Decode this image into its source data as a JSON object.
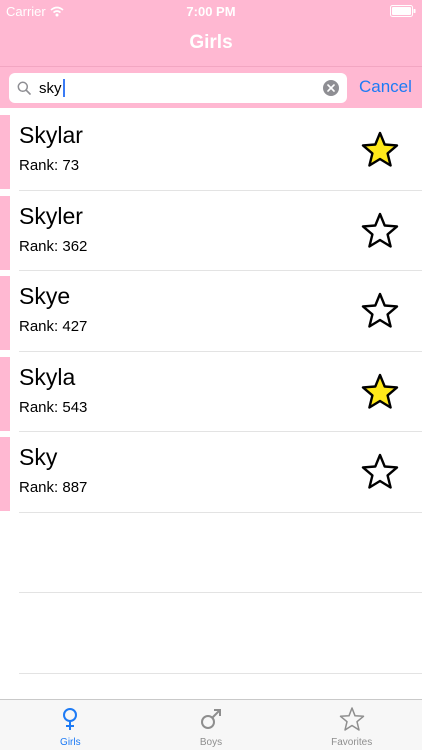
{
  "status_bar": {
    "carrier": "Carrier",
    "time": "7:00 PM"
  },
  "nav": {
    "title": "Girls"
  },
  "search": {
    "value": "sky",
    "cancel_label": "Cancel"
  },
  "results": [
    {
      "name": "Skylar",
      "rank": "Rank: 73",
      "favorite": true
    },
    {
      "name": "Skyler",
      "rank": "Rank: 362",
      "favorite": false
    },
    {
      "name": "Skye",
      "rank": "Rank: 427",
      "favorite": false
    },
    {
      "name": "Skyla",
      "rank": "Rank: 543",
      "favorite": true
    },
    {
      "name": "Sky",
      "rank": "Rank: 887",
      "favorite": false
    }
  ],
  "tabs": [
    {
      "label": "Girls",
      "icon": "female-icon",
      "active": true
    },
    {
      "label": "Boys",
      "icon": "male-icon",
      "active": false
    },
    {
      "label": "Favorites",
      "icon": "star-outline-icon",
      "active": false
    }
  ],
  "colors": {
    "accent_pink": "#ffb8d2",
    "link_blue": "#1e7bf5",
    "star_fill": "#ffe81a"
  }
}
